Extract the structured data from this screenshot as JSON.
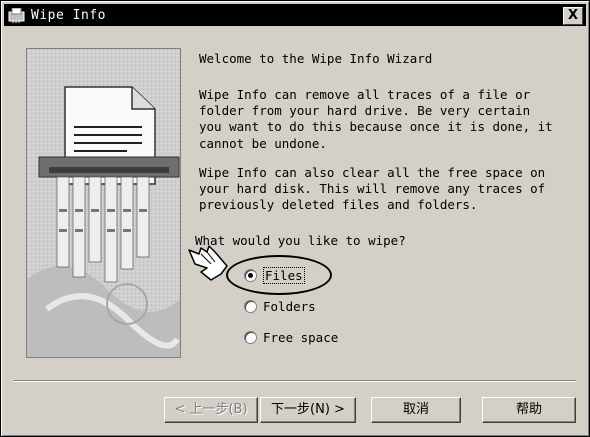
{
  "window": {
    "title": "Wipe Info",
    "close_label": "X"
  },
  "wizard": {
    "heading": "Welcome to the Wipe Info Wizard",
    "paragraph1": "Wipe Info can remove all traces of a file or\nfolder from your hard drive. Be very certain\nyou want to do this because once it is done, it\ncannot be undone.",
    "paragraph2": "Wipe Info can also clear all the free space on\nyour hard disk. This will remove any traces of\npreviously deleted files and folders.",
    "question": "What would you like to wipe?",
    "options": [
      {
        "label": "Files",
        "checked": true
      },
      {
        "label": "Folders",
        "checked": false
      },
      {
        "label": "Free space",
        "checked": false
      }
    ]
  },
  "buttons": {
    "back": "< 上一步(B)",
    "next": "下一步(N) >",
    "cancel": "取消",
    "help": "帮助"
  }
}
